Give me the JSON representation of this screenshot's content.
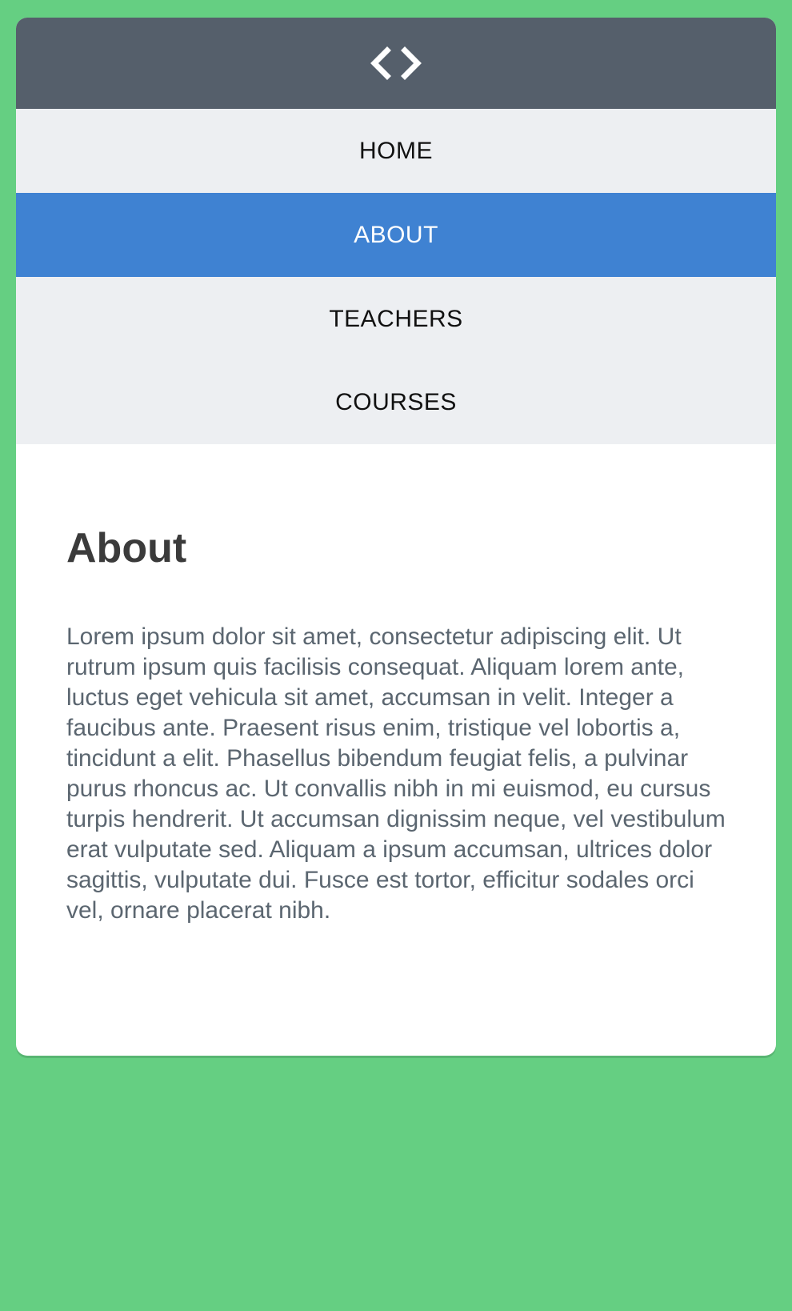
{
  "header": {
    "logo_icon": "code-brackets-icon"
  },
  "nav": {
    "items": [
      {
        "label": "HOME"
      },
      {
        "label": "ABOUT"
      },
      {
        "label": "TEACHERS"
      },
      {
        "label": "COURSES"
      }
    ],
    "active_index": 1
  },
  "main": {
    "title": "About",
    "body": "Lorem ipsum dolor sit amet, consectetur adipiscing elit. Ut rutrum ipsum quis facilisis consequat. Aliquam lorem ante, luctus eget vehicula sit amet, accumsan in velit. Integer a faucibus ante. Praesent risus enim, tristique vel lobortis a, tincidunt a elit. Phasellus bibendum feugiat felis, a pulvinar purus rhoncus ac. Ut convallis nibh in mi euismod, eu cursus turpis hendrerit. Ut accumsan dignissim neque, vel vestibulum erat vulputate sed. Aliquam a ipsum accumsan, ultrices dolor sagittis, vulputate dui. Fusce est tortor, efficitur sodales orci vel, ornare placerat nibh."
  },
  "colors": {
    "page_background": "#65cf82",
    "header_background": "#555f6b",
    "nav_background": "#edeff2",
    "active_nav": "#3f82d2",
    "heading_text": "#3b3b3b",
    "body_text": "#5b6670"
  }
}
